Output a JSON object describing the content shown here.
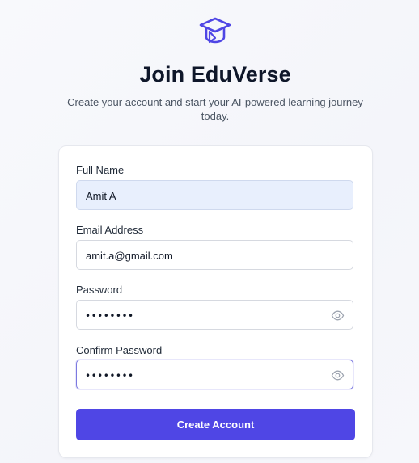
{
  "brand": {
    "icon": "graduation-cap-icon",
    "accent_color": "#4f46e5"
  },
  "header": {
    "title": "Join EduVerse",
    "subtitle": "Create your account and start your AI-powered learning journey today."
  },
  "form": {
    "full_name": {
      "label": "Full Name",
      "value": "Amit A"
    },
    "email": {
      "label": "Email Address",
      "value": "amit.a@gmail.com"
    },
    "password": {
      "label": "Password",
      "masked_value": "••••••••",
      "toggle_icon": "eye-icon"
    },
    "confirm_password": {
      "label": "Confirm Password",
      "masked_value": "••••••••",
      "toggle_icon": "eye-icon"
    },
    "submit_label": "Create Account"
  }
}
